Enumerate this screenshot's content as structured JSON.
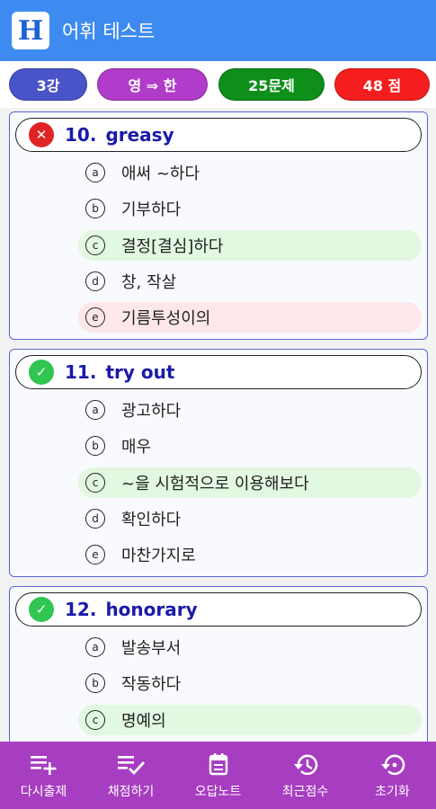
{
  "app": {
    "title": "어휘 테스트",
    "logo_letter": "H"
  },
  "pills": {
    "lecture": "3강",
    "mode": "영 ⇒ 한",
    "count": "25문제",
    "score": "48 점"
  },
  "questions": [
    {
      "number": "10.",
      "word": "greasy",
      "status": "wrong",
      "options": [
        {
          "letter": "a",
          "text": "애써 ~하다",
          "state": "none"
        },
        {
          "letter": "b",
          "text": "기부하다",
          "state": "none"
        },
        {
          "letter": "c",
          "text": "결정[결심]하다",
          "state": "correct"
        },
        {
          "letter": "d",
          "text": "창, 작살",
          "state": "none"
        },
        {
          "letter": "e",
          "text": "기름투성이의",
          "state": "selected-wrong"
        }
      ]
    },
    {
      "number": "11.",
      "word": "try out",
      "status": "right",
      "options": [
        {
          "letter": "a",
          "text": "광고하다",
          "state": "none"
        },
        {
          "letter": "b",
          "text": "매우",
          "state": "none"
        },
        {
          "letter": "c",
          "text": "~을 시험적으로 이용해보다",
          "state": "correct"
        },
        {
          "letter": "d",
          "text": "확인하다",
          "state": "none"
        },
        {
          "letter": "e",
          "text": "마찬가지로",
          "state": "none"
        }
      ]
    },
    {
      "number": "12.",
      "word": "honorary",
      "status": "right",
      "options": [
        {
          "letter": "a",
          "text": "발송부서",
          "state": "none"
        },
        {
          "letter": "b",
          "text": "작동하다",
          "state": "none"
        },
        {
          "letter": "c",
          "text": "명예의",
          "state": "correct"
        }
      ]
    }
  ],
  "bottom_nav": [
    {
      "label": "다시출제",
      "icon": "playlist-add-icon"
    },
    {
      "label": "채점하기",
      "icon": "playlist-check-icon"
    },
    {
      "label": "오답노트",
      "icon": "calendar-icon"
    },
    {
      "label": "최근점수",
      "icon": "history-icon"
    },
    {
      "label": "초기화",
      "icon": "restore-icon"
    }
  ],
  "colors": {
    "appbar": "#3d8bf0",
    "lecture_pill": "#4854c7",
    "mode_pill": "#b03cc9",
    "count_pill": "#0d8f19",
    "score_pill": "#f51e1e",
    "bottombar": "#a73dc0",
    "correct_bg": "#e3f8e0",
    "wrong_bg": "#fde7ea"
  }
}
